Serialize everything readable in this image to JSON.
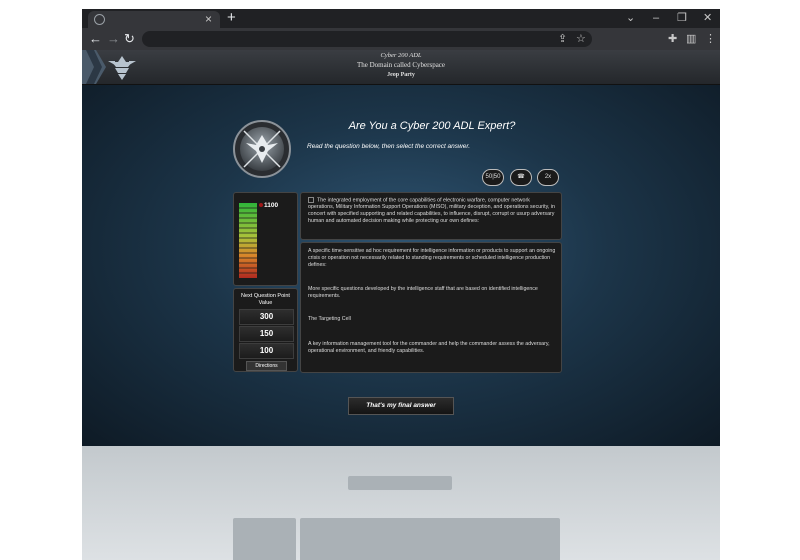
{
  "browser": {
    "new_tab_label": "+",
    "close_tab_label": "×",
    "window_controls": {
      "minimize": "⌄",
      "min": "–",
      "restore": "❐",
      "close": "✕"
    }
  },
  "site": {
    "course": "Cyber 200 ADL",
    "section": "The Domain called Cyberspace",
    "game": "Jeop Party"
  },
  "game": {
    "title": "Are You a Cyber 200 ADL Expert?",
    "instructions": "Read the question below, then select the correct answer.",
    "lifelines": [
      "50|50",
      "☎",
      "2x"
    ],
    "score": "1100",
    "next_question_label": "Next Question Point Value",
    "point_values": [
      "300",
      "150",
      "100"
    ],
    "directions_label": "Directions",
    "question": "The integrated employment of the core capabilities of electronic warfare, computer network operations, Military Information Support Operations (MISO), military deception, and operations security, in concert with specified supporting and related capabilities, to influence, disrupt, corrupt or usurp adversary human and automated decision making while protecting our own defines:",
    "answers": [
      "A specific time-sensitive ad hoc requirement for intelligence information or products to support an ongoing crisis or operation not necessarily related to standing requirements or scheduled intelligence production defines:",
      "More specific questions developed by the intelligence staff that are based on identified intelligence requirements.",
      "The Targeting Cell",
      "A key information management tool for the commander and help the commander assess the adversary, operational environment, and friendly capabilities."
    ],
    "final_answer_label": "That's my final answer"
  },
  "colors": {
    "accent": "#c9a94b",
    "panel": "#1b1b1b",
    "background": "#1c3549"
  }
}
